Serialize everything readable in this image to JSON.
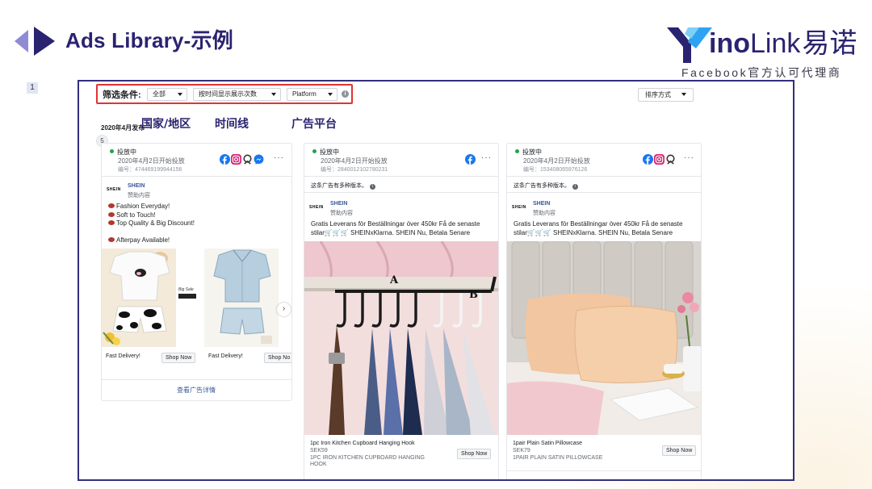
{
  "slide": {
    "title": "Ads Library-示例",
    "page_number": "1",
    "accent_color": "#2a2370"
  },
  "logo": {
    "letter_y": "Y",
    "text_ino": "ino",
    "text_link": "Link",
    "text_cn": "易诺",
    "subtitle": "Facebook官方认可代理商"
  },
  "filter_bar": {
    "label": "筛选条件:",
    "country_dropdown": "全部",
    "timeline_dropdown": "按时间显示展示次数",
    "platform_dropdown": "Platform",
    "sort_dropdown": "排序方式",
    "border_color": "#e03434"
  },
  "annotations": {
    "country": "国家/地区",
    "timeline": "时间线",
    "platform": "广告平台"
  },
  "published_date": "2020年4月发布",
  "version_count": "5",
  "cards": [
    {
      "status": "投放中",
      "started": "2020年4月2日开始投放",
      "id": "编号：474469199944156",
      "platform_icons": [
        "facebook-icon",
        "instagram-icon",
        "audience-network-icon",
        "messenger-icon"
      ],
      "brand_logo": "SHEIN",
      "brand": "SHEIN",
      "sponsored": "赞助内容",
      "lines": [
        "Fashion Everyday!",
        "Soft to Touch!",
        "Top Quality & Big Discount!",
        "Afterpay Available!"
      ],
      "carousel": [
        {
          "title": "Fast Delivery!",
          "cta": "Shop Now"
        },
        {
          "title": "Fast Delivery!",
          "cta": "Shop No"
        }
      ],
      "sticker_text": "Big Sale",
      "details_link": "查看广告详情"
    },
    {
      "status": "投放中",
      "started": "2020年4月2日开始投放",
      "id": "编号：2840012102780231",
      "platform_icons": [
        "facebook-icon"
      ],
      "versions_note": "这条广告有多种版本。",
      "brand_logo": "SHEIN",
      "brand": "SHEIN",
      "sponsored": "赞助内容",
      "text": "Gratis Leverans för Beställningar över 450kr Få de senaste stilar🛒🛒🛒 SHEINxKlarna. SHEIN Nu, Betala Senare",
      "image_labels": [
        "A",
        "B"
      ],
      "footer_title": "1pc Iron Kitchen Cupboard Hanging Hook",
      "footer_price": "SEK59",
      "footer_desc": "1PC IRON KITCHEN CUPBOARD HANGING HOOK",
      "cta": "Shop Now"
    },
    {
      "status": "投放中",
      "started": "2020年4月2日开始投放",
      "id": "编号：153408065976126",
      "platform_icons": [
        "facebook-icon",
        "instagram-icon",
        "audience-network-icon"
      ],
      "versions_note": "这条广告有多种版本。",
      "brand_logo": "SHEIN",
      "brand": "SHEIN",
      "sponsored": "赞助内容",
      "text": "Gratis Leverans för Beställningar över 450kr Få de senaste stilar🛒🛒🛒 SHEINxKlarna. SHEIN Nu, Betala Senare",
      "footer_title": "1pair Plain Satin Pillowcase",
      "footer_price": "SEK79",
      "footer_desc": "1PAIR PLAIN SATIN PILLOWCASE",
      "cta": "Shop Now"
    }
  ]
}
